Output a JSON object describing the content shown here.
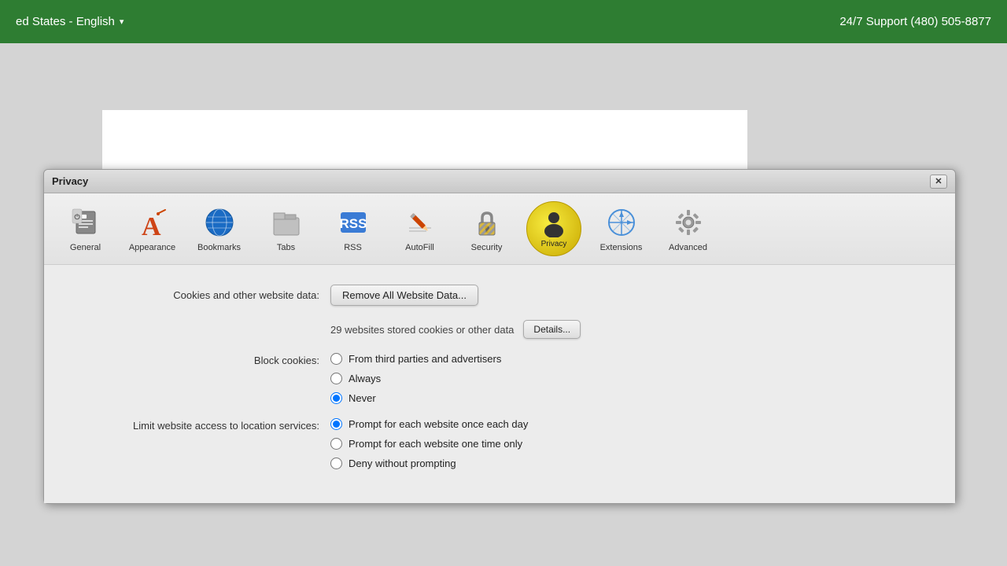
{
  "topbar": {
    "region": "ed States - English",
    "region_arrow": "▾",
    "support": "24/7 Support (480) 505-8877"
  },
  "dialog": {
    "title": "Privacy",
    "close_label": "✕"
  },
  "toolbar": {
    "items": [
      {
        "id": "general",
        "label": "General",
        "icon": "general"
      },
      {
        "id": "appearance",
        "label": "Appearance",
        "icon": "appearance"
      },
      {
        "id": "bookmarks",
        "label": "Bookmarks",
        "icon": "bookmarks"
      },
      {
        "id": "tabs",
        "label": "Tabs",
        "icon": "tabs"
      },
      {
        "id": "rss",
        "label": "RSS",
        "icon": "rss"
      },
      {
        "id": "autofill",
        "label": "AutoFill",
        "icon": "autofill"
      },
      {
        "id": "security",
        "label": "Security",
        "icon": "security"
      },
      {
        "id": "privacy",
        "label": "Privacy",
        "icon": "privacy",
        "active": true
      },
      {
        "id": "extensions",
        "label": "Extensions",
        "icon": "extensions"
      },
      {
        "id": "advanced",
        "label": "Advanced",
        "icon": "advanced"
      }
    ]
  },
  "content": {
    "cookies_label": "Cookies and other website data:",
    "remove_all_btn": "Remove All Website Data...",
    "websites_info": "29 websites stored cookies or other data",
    "details_btn": "Details...",
    "block_cookies_label": "Block cookies:",
    "block_options": [
      {
        "id": "third_parties",
        "label": "From third parties and advertisers",
        "checked": false
      },
      {
        "id": "always",
        "label": "Always",
        "checked": false
      },
      {
        "id": "never",
        "label": "Never",
        "checked": true
      }
    ],
    "location_label": "Limit website access to location services:",
    "location_options": [
      {
        "id": "prompt_daily",
        "label": "Prompt for each website once each day",
        "checked": true
      },
      {
        "id": "prompt_once",
        "label": "Prompt for each website one time only",
        "checked": false
      },
      {
        "id": "deny",
        "label": "Deny without prompting",
        "checked": false
      }
    ]
  }
}
